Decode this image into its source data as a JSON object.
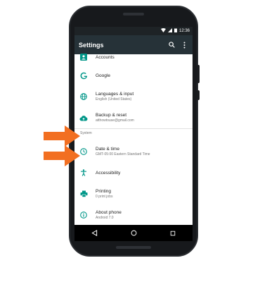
{
  "status": {
    "time": "12:36"
  },
  "appbar": {
    "title": "Settings"
  },
  "items": [
    {
      "label": "Accounts",
      "sub": ""
    },
    {
      "label": "Google",
      "sub": ""
    },
    {
      "label": "Languages & input",
      "sub": "English (United States)"
    },
    {
      "label": "Backup & reset",
      "sub": "atthowtouse@gmail.com"
    }
  ],
  "section": "System",
  "system_items": [
    {
      "label": "Date & time",
      "sub": "GMT-05:00 Eastern Standard Time"
    },
    {
      "label": "Accessibility",
      "sub": ""
    },
    {
      "label": "Printing",
      "sub": "0 print jobs"
    },
    {
      "label": "About phone",
      "sub": "Android 7.0"
    }
  ],
  "colors": {
    "accent": "#009688",
    "appbar": "#263238",
    "arrow": "#f26f21"
  },
  "icons": [
    "account-icon",
    "google-icon",
    "globe-icon",
    "cloud-icon",
    "clock-icon",
    "accessibility-icon",
    "printer-icon",
    "info-icon",
    "back-icon",
    "home-icon",
    "recents-icon",
    "search-icon",
    "more-icon"
  ]
}
